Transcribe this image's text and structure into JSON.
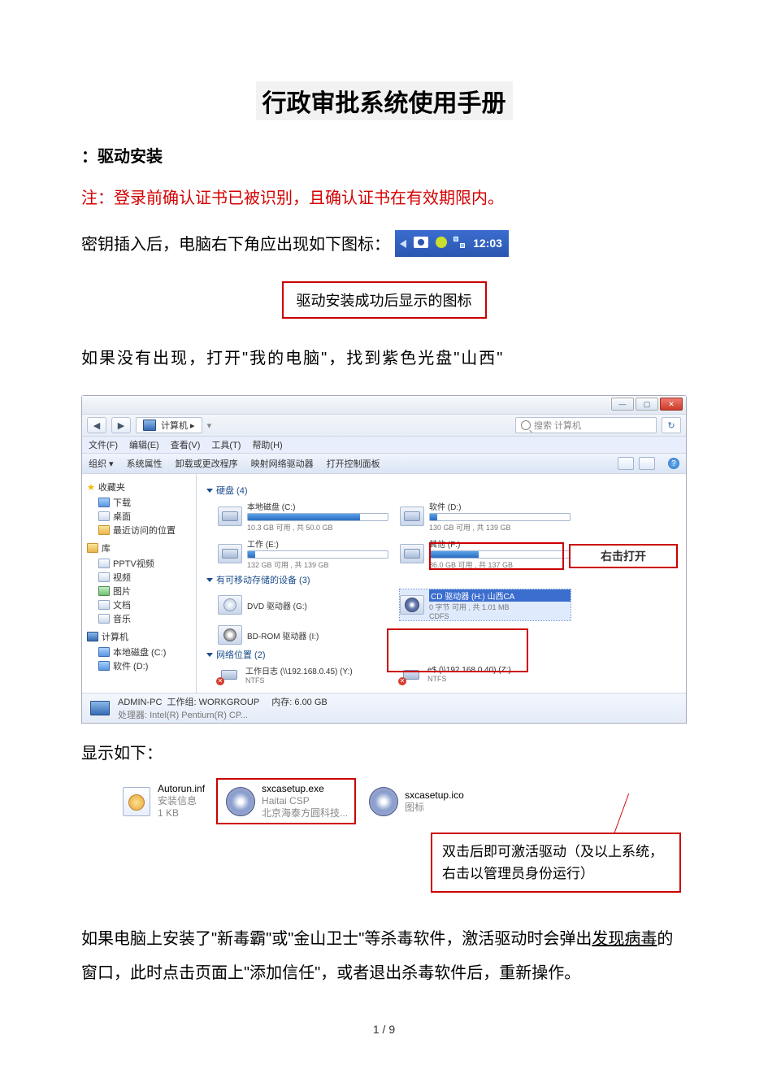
{
  "title": "行政审批系统使用手册",
  "h2": "：驱动安装",
  "note": "注：登录前确认证书已被识别，且确认证书在有效期限内。",
  "intro_prefix": "密钥插入后，电脑右下角应出现如下图标：",
  "taskbar": {
    "time": "12:03"
  },
  "callout1": "驱动安装成功后显示的图标",
  "para2": "如果没有出现，打开\"我的电脑\"，找到紫色光盘\"山西\"",
  "explorer": {
    "address": {
      "label": "计算机 ▸",
      "refresh": "↻"
    },
    "search": {
      "placeholder": "搜索 计算机"
    },
    "menu": [
      "文件(F)",
      "编辑(E)",
      "查看(V)",
      "工具(T)",
      "帮助(H)"
    ],
    "toolbar": [
      "组织 ▾",
      "系统属性",
      "卸载或更改程序",
      "映射网络驱动器",
      "打开控制面板"
    ],
    "view_icons": {
      "grid": "⊞",
      "list": "≡"
    },
    "help": "?",
    "sidebar": {
      "fav": {
        "caption": "收藏夹",
        "items": [
          "下载",
          "桌面",
          "最近访问的位置"
        ]
      },
      "lib": {
        "caption": "库",
        "items": [
          "PPTV视频",
          "视频",
          "图片",
          "文档",
          "音乐"
        ]
      },
      "comp": {
        "caption": "计算机",
        "items": [
          "本地磁盘 (C:)",
          "软件 (D:)"
        ]
      }
    },
    "groups": {
      "disks": {
        "label": "硬盘 (4)",
        "items": [
          {
            "name": "本地磁盘 (C:)",
            "fill": 80,
            "sub": "10.3 GB 可用 , 共 50.0 GB"
          },
          {
            "name": "软件 (D:)",
            "fill": 5,
            "sub": "130 GB 可用 , 共 139 GB"
          },
          {
            "name": "工作 (E:)",
            "fill": 5,
            "sub": "132 GB 可用 , 共 139 GB"
          },
          {
            "name": "其他 (F:)",
            "fill": 35,
            "sub": "86.0 GB 可用 , 共 137 GB"
          }
        ]
      },
      "removable": {
        "label": "有可移动存储的设备 (3)",
        "items": [
          {
            "name": "DVD 驱动器 (G:)"
          },
          {
            "name": "CD 驱动器 (H:) 山西CA",
            "sub": "0 字节 可用 , 共 1.01 MB",
            "sub2": "CDFS"
          },
          {
            "name": "BD-ROM 驱动器 (I:)"
          }
        ]
      },
      "network": {
        "label": "网络位置 (2)",
        "items": [
          {
            "name": "工作日志 (\\\\192.168.0.45) (Y:)",
            "sub": "NTFS"
          },
          {
            "name": "e$ (\\\\192.168.0.40) (Z:)",
            "sub": "NTFS"
          }
        ]
      }
    },
    "status": {
      "name": "ADMIN-PC",
      "workgroup": "工作组: WORKGROUP",
      "mem": "内存: 6.00 GB",
      "cpu": "处理器: Intel(R) Pentium(R) CP..."
    },
    "callout_right": "右击打开"
  },
  "after_explorer": "显示如下：",
  "files": [
    {
      "name": "Autorun.inf",
      "sub1": "安装信息",
      "sub2": "1 KB"
    },
    {
      "name": "sxcasetup.exe",
      "sub1": "Haitai CSP",
      "sub2": "北京海泰方圆科技..."
    },
    {
      "name": "sxcasetup.ico",
      "sub1": "图标",
      "sub2": ""
    }
  ],
  "callout_dbl": "双击后即可激活驱动（及以上系统，右击以管理员身份运行）",
  "final_para_parts": {
    "a": "如果电脑上安装了\"新毒霸\"或\"金山卫士\"等杀毒软件，激活驱动时会弹出",
    "ul": "发现病毒",
    "b": "的窗口，此时点击页面上\"添加信任\"，或者退出杀毒软件后，重新操作。"
  },
  "footer": "1 / 9"
}
